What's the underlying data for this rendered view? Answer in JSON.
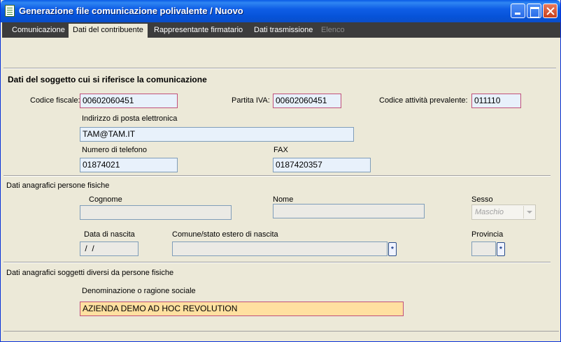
{
  "window": {
    "title": "Generazione file comunicazione polivalente / Nuovo"
  },
  "tabs": [
    {
      "label": "Comunicazione"
    },
    {
      "label": "Dati del contribuente"
    },
    {
      "label": "Rappresentante firmatario"
    },
    {
      "label": "Dati trasmissione"
    },
    {
      "label": "Elenco"
    }
  ],
  "soggetto": {
    "title": "Dati del soggetto cui si riferisce la comunicazione",
    "codice_fiscale_label": "Codice fiscale:",
    "codice_fiscale": "00602060451",
    "partita_iva_label": "Partita IVA:",
    "partita_iva": "00602060451",
    "codice_attivita_label": "Codice attività prevalente:",
    "codice_attivita": "011110",
    "email_label": "Indirizzo di posta elettronica",
    "email": "TAM@TAM.IT",
    "telefono_label": "Numero di telefono",
    "telefono": "01874021",
    "fax_label": "FAX",
    "fax": "0187420357"
  },
  "persone_fisiche": {
    "title": "Dati anagrafici persone fisiche",
    "cognome_label": "Cognome",
    "cognome": "",
    "nome_label": "Nome",
    "nome": "",
    "sesso_label": "Sesso",
    "sesso": "Maschio",
    "data_nascita_label": "Data di nascita",
    "data_nascita": " /  /",
    "comune_label": "Comune/stato estero di nascita",
    "comune": "",
    "provincia_label": "Provincia",
    "provincia": "",
    "zoom_glyph": "*"
  },
  "diversi": {
    "title": "Dati anagrafici soggetti diversi da persone fisiche",
    "denominazione_label": "Denominazione o ragione sociale",
    "denominazione": "AZIENDA DEMO AD HOC REVOLUTION"
  }
}
